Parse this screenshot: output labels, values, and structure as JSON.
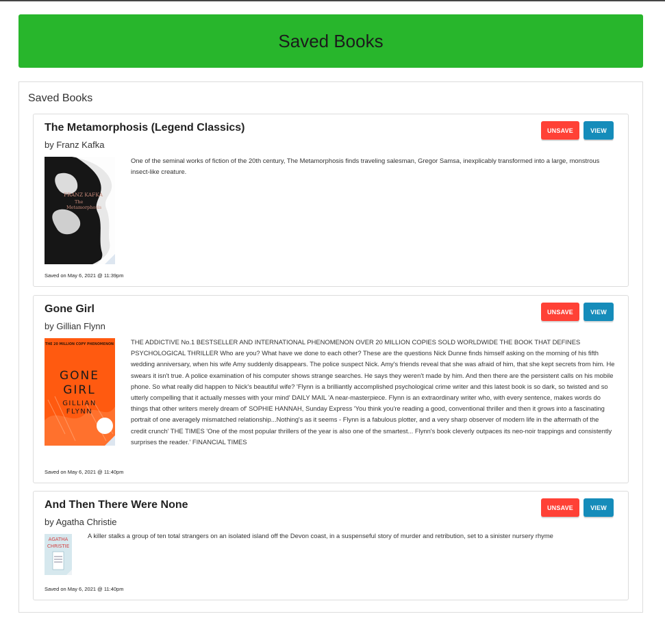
{
  "header": {
    "title": "Saved Books"
  },
  "panel": {
    "title": "Saved Books"
  },
  "buttons": {
    "unsave": "UNSAVE",
    "view": "VIEW"
  },
  "books": [
    {
      "title": "The Metamorphosis (Legend Classics)",
      "author": "by Franz Kafka",
      "description": "One of the seminal works of fiction of the 20th century, The Metamorphosis finds traveling salesman, Gregor Samsa, inexplicably transformed into a large, monstrous insect-like creature.",
      "saved": "Saved on May 6, 2021 @ 11:39pm",
      "cover": {
        "author": "FRANZ KAFKA",
        "title": "The Metamorphosis"
      }
    },
    {
      "title": "Gone Girl",
      "author": "by Gillian Flynn",
      "description": "THE ADDICTIVE No.1 BESTSELLER AND INTERNATIONAL PHENOMENON OVER 20 MILLION COPIES SOLD WORLDWIDE THE BOOK THAT DEFINES PSYCHOLOGICAL THRILLER Who are you? What have we done to each other? These are the questions Nick Dunne finds himself asking on the morning of his fifth wedding anniversary, when his wife Amy suddenly disappears. The police suspect Nick. Amy's friends reveal that she was afraid of him, that she kept secrets from him. He swears it isn't true. A police examination of his computer shows strange searches. He says they weren't made by him. And then there are the persistent calls on his mobile phone. So what really did happen to Nick's beautiful wife? 'Flynn is a brilliantly accomplished psychological crime writer and this latest book is so dark, so twisted and so utterly compelling that it actually messes with your mind' DAILY MAIL 'A near-masterpiece. Flynn is an extraordinary writer who, with every sentence, makes words do things that other writers merely dream of' SOPHIE HANNAH, Sunday Express 'You think you're reading a good, conventional thriller and then it grows into a fascinating portrait of one averagely mismatched relationship...Nothing's as it seems - Flynn is a fabulous plotter, and a very sharp observer of modern life in the aftermath of the credit crunch' THE TIMES 'One of the most popular thrillers of the year is also one of the smartest... Flynn's book cleverly outpaces its neo-noir trappings and consistently surprises the reader.' FINANCIAL TIMES",
      "saved": "Saved on May 6, 2021 @ 11:40pm",
      "cover": {
        "banner": "THE 20 MILLION COPY PHENOMENON",
        "line1": "GONE",
        "line2": "GIRL",
        "author1": "GILLIAN",
        "author2": "FLYNN"
      }
    },
    {
      "title": "And Then There Were None",
      "author": "by Agatha Christie",
      "description": "A killer stalks a group of ten total strangers on an isolated island off the Devon coast, in a suspenseful story of murder and retribution, set to a sinister nursery rhyme",
      "saved": "Saved on May 6, 2021 @ 11:40pm",
      "cover": {
        "line1": "AGATHA",
        "line2": "CHRISTIE"
      }
    }
  ],
  "colors": {
    "banner": "#28b62c",
    "unsave": "#ff4136",
    "view": "#158cba"
  }
}
